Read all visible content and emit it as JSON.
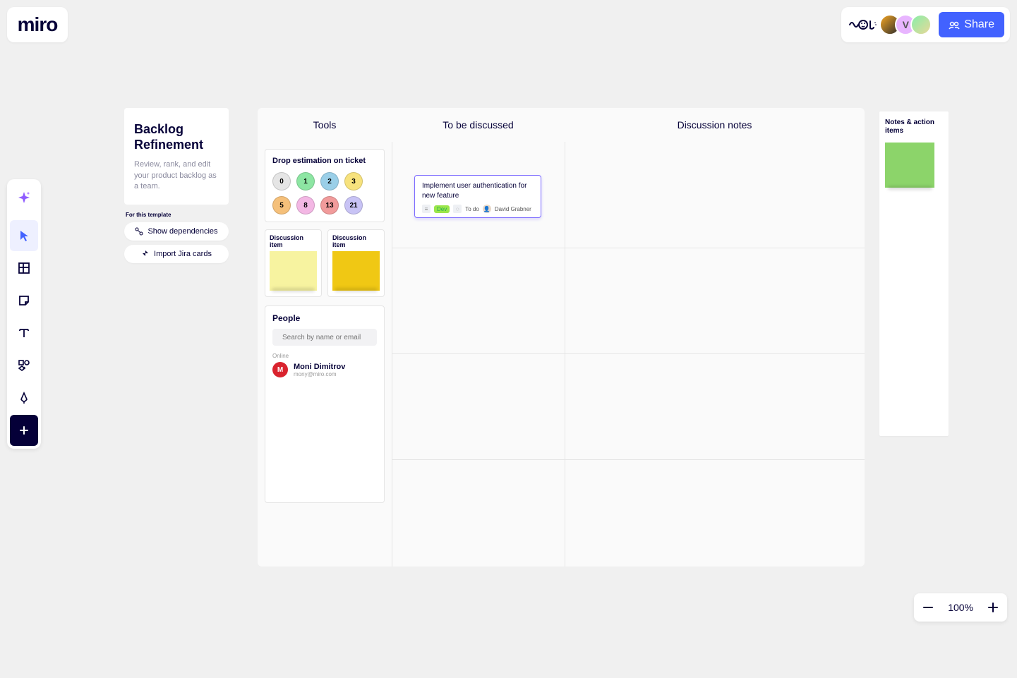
{
  "logo_text": "miro",
  "topbar": {
    "share_label": "Share",
    "avatars": [
      {
        "bg": "linear-gradient(135deg,#f5a623,#2c2c2c)",
        "letter": ""
      },
      {
        "bg": "#e8b5ff",
        "letter": "V"
      },
      {
        "bg": "linear-gradient(135deg,#8ea,#e8d898)",
        "letter": ""
      }
    ]
  },
  "template": {
    "title": "Backlog Refinement",
    "subtitle": "Review, rank, and edit your product backlog as a team.",
    "for_label": "For this template",
    "btn_deps": "Show dependencies",
    "btn_jira": "Import Jira cards"
  },
  "board": {
    "col_tools": "Tools",
    "col_discuss": "To be discussed",
    "col_notes": "Discussion notes"
  },
  "estimation": {
    "title": "Drop estimation on ticket",
    "chips": [
      {
        "v": "0",
        "bg": "#e5e5e5"
      },
      {
        "v": "1",
        "bg": "#8de6a3"
      },
      {
        "v": "2",
        "bg": "#9acfe8"
      },
      {
        "v": "3",
        "bg": "#f7e27d"
      },
      {
        "v": "5",
        "bg": "#f5c07a"
      },
      {
        "v": "8",
        "bg": "#f3b7e4"
      },
      {
        "v": "13",
        "bg": "#f19b9b"
      },
      {
        "v": "21",
        "bg": "#c8c3f5"
      }
    ]
  },
  "discussion": {
    "label": "Discussion item",
    "sticky_colors": [
      "#f7f3a0",
      "#f0c814"
    ]
  },
  "people": {
    "title": "People",
    "search_placeholder": "Search by name or email",
    "online_label": "Online",
    "person_name": "Moni Dimitrov",
    "person_email": "mony@miro.com",
    "person_initial": "M"
  },
  "ticket": {
    "title": "Implement user authentication for new feature",
    "dev_label": "Dev",
    "status": "To do",
    "assignee": "David Grabner"
  },
  "notes_panel": {
    "title": "Notes & action items"
  },
  "zoom": {
    "level": "100%"
  }
}
